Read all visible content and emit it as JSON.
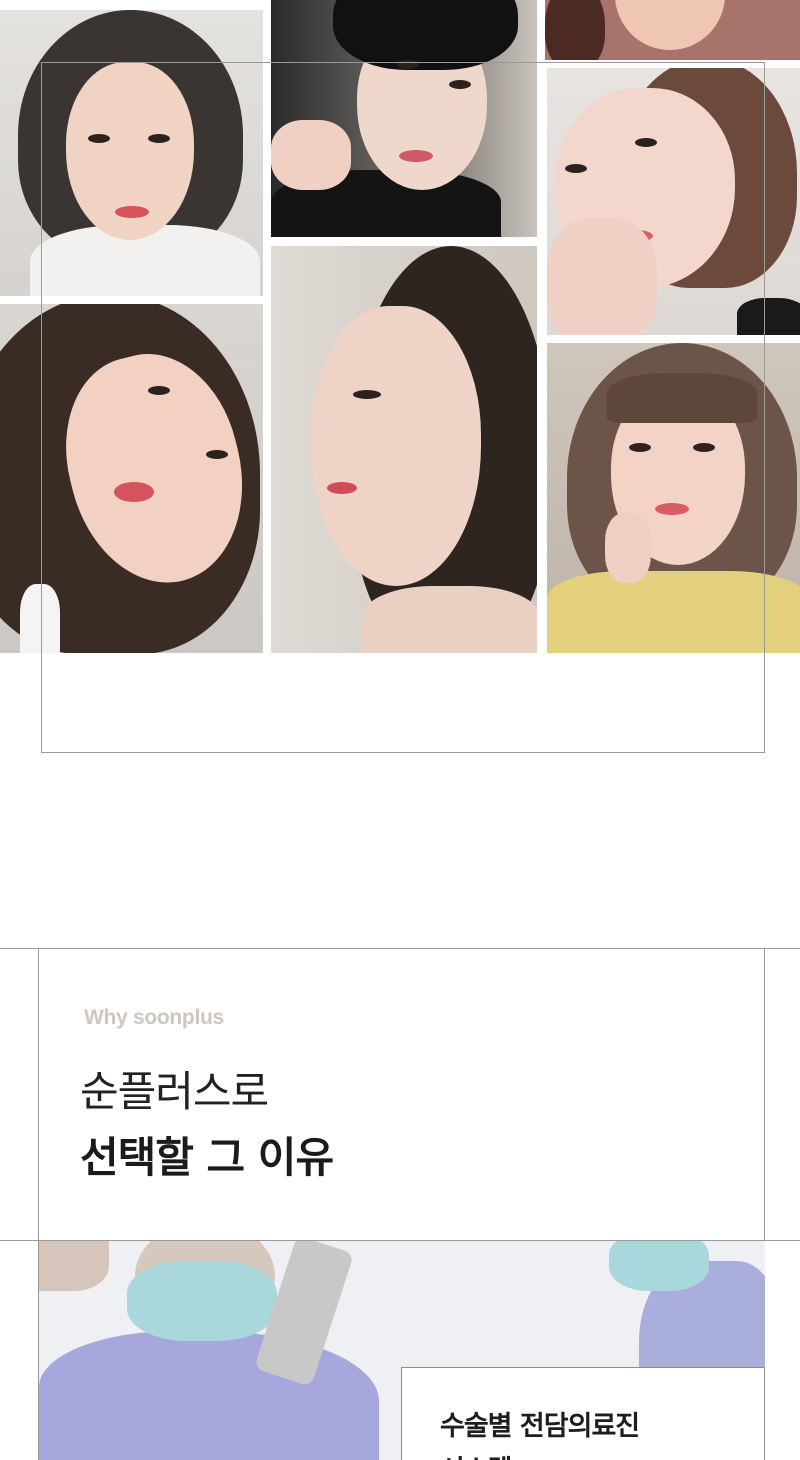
{
  "gallery": {
    "photos": [
      {
        "name": "portrait-woman-bob-hair",
        "alt": ""
      },
      {
        "name": "portrait-man-dark-hair",
        "alt": ""
      },
      {
        "name": "portrait-woman-top-right",
        "alt": ""
      },
      {
        "name": "portrait-woman-hand-on-cheek",
        "alt": ""
      },
      {
        "name": "portrait-woman-long-hair-tilted",
        "alt": ""
      },
      {
        "name": "portrait-woman-side-profile",
        "alt": ""
      },
      {
        "name": "portrait-woman-bangs",
        "alt": ""
      }
    ]
  },
  "why": {
    "eyebrow": "Why soonplus",
    "line1": "순플러스로",
    "line2": "선택할 그 이유"
  },
  "feature": {
    "title": "수술별 전담의료진",
    "subtitle": "시스템"
  },
  "colors": {
    "eyebrow": "#cfc7bf",
    "text": "#1b1b1b",
    "frame": "#9a9a9a",
    "scrubs": "#a6a7dd",
    "mask": "#a9d7dc"
  }
}
